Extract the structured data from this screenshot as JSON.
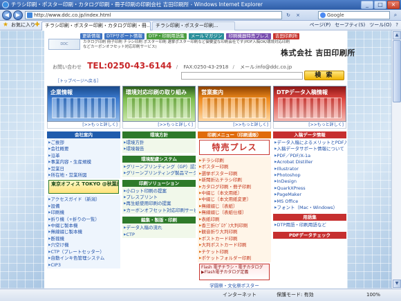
{
  "window": {
    "title": "チラシ印刷・ポスター印刷・カタログ印刷・冊子印刷の印刷会社 吉田印刷所 - Windows Internet Explorer",
    "minimize": "_",
    "maximize": "□",
    "close": "×"
  },
  "address": {
    "back": "◀",
    "forward": "▶",
    "url": "http://www.ddc.co.jp/index.html",
    "refresh": "↻",
    "stop": "×",
    "search_engine": "Google",
    "search_go": "⌕"
  },
  "favorites": {
    "label": "お気に入り",
    "tab_active": "チラシ印刷・ポスター印刷・カタログ印刷・冊...",
    "tab_other": "チラシ印刷・ポスター印刷...",
    "commands": [
      "ページ(P)",
      "セーフティ(S)",
      "ツール(O)",
      "?"
    ]
  },
  "site": {
    "topnav": [
      "更新情報",
      "DTPサポート情報",
      "DTP・印刷用語集",
      "メールマガジン",
      "印刷機器特売プレス",
      "吉田印刷所"
    ],
    "logo_text": "DDC",
    "tagline": "カタログ印刷 冊子印刷 チラシ印刷 ポスター印刷 選挙ポスター印刷など御要望な印刷会社です(PDF入稿OK/環境対応印刷などカーボンオフセット対応印刷サービス)",
    "company": "株式会社 吉田印刷所",
    "contact_label": "お問い合わせ",
    "tel": "TEL:0250-43-6144",
    "fax": "FAX:0250-43-2918",
    "mail": "メール:info@ddc.co.jp",
    "sep": "/",
    "search_button": "検 索",
    "breadcrumb": "［トップページへ戻る］"
  },
  "columns": {
    "c1": {
      "title": "企業情報",
      "more": "[>>もっと詳しく]",
      "section": "会社案内",
      "items": [
        "ご挨拶",
        "会社概要",
        "沿革",
        "事業内容・生産規模",
        "営業日",
        "所在地・営業所図"
      ],
      "tokyo": "東京オフィス TOKYO @秋葉原",
      "items2": [
        "アクセスガイド（新潟）",
        "設備",
        "印刷機",
        "折り機（+折りの一覧）",
        "中綴じ製本機",
        "無線綴じ製本機",
        "断裁機",
        "穴空け機",
        "CTP（プレートセッター）",
        "自動インキ色管理システム",
        "CIP3"
      ]
    },
    "c2": {
      "title": "環境対応印刷の取り組み",
      "more": "[>>もっと詳しく]",
      "section1": "環境方針",
      "items1": [
        "環境方針",
        "環境報告"
      ],
      "section2": "環境配慮システム",
      "items2": [
        "グリーンプリンティング（GP）認定工場",
        "グリーンプリンティング製品マーク（GP製品マーク）"
      ],
      "section3": "印刷ソリューション",
      "items3": [
        "小ロット印刷の提案",
        "プレスプリント",
        "再生紙使用印刷の提案",
        "カーボンオフセット対応印刷サービス"
      ],
      "section4": "編集・製版・印刷",
      "items4": [
        "データ入稿の流れ",
        "CTP"
      ]
    },
    "c3": {
      "title": "営業案内",
      "more": "[>>もっと詳しく]",
      "section": "印刷メニュー（印刷通販）",
      "tokubare": "特売プレス",
      "items": [
        "チラシ印刷",
        "ポスター印刷",
        "選挙ポスター印刷",
        "新聞折込チラシ印刷",
        "カタログ印刷・冊子印刷",
        "中綴じ〔本文用紙〕",
        "中綴じ〔本文用紙変更〕",
        "無線綴じ〔表紙〕",
        "無線綴じ〔表紙仕様〕",
        "表紙印刷",
        "香三折(ﾌﾞﾛｸﾞ)大判印刷",
        "観音折り大判印刷",
        "ポストカード印刷",
        "大判ポストカード印刷",
        "チケット印刷",
        "ポケットフォルダー印刷"
      ],
      "flash": "Flash 電子チラシ・電子カタログ ▶Flash電子カタログ定義",
      "footer": "学園祭・文化祭ポスター"
    },
    "c4": {
      "title": "DTPデータ入稿情報",
      "more": "[>>もっと詳しく]",
      "section": "入稿データ情報",
      "items": [
        "データ入稿によるメリットとPDF入稿について【1 2 3】",
        "入稿データサポート情報について",
        "PDF／PDF/X-1a",
        "Acrobat Distiller",
        "Illustrator",
        "Photoshop",
        "InDesign",
        "QuarkXPress",
        "PageMaker",
        "MS Office",
        "フォント（Mac・Windows）"
      ],
      "section2": "用語集",
      "items2": [
        "DTP用語・印刷用語など"
      ],
      "section3": "PDFデータチェック"
    }
  },
  "status": {
    "left": "",
    "zone": "インターネット",
    "protected": "保護モード: 有効",
    "zoom": "100%"
  },
  "colors": {
    "tel_red": "#c8282a",
    "brand_blue": "#1f5cad",
    "env_green": "#2e7a2a",
    "sales_orange": "#e06b0c",
    "dtp_red": "#c62f2f",
    "search_yellow": "#f0b400"
  }
}
